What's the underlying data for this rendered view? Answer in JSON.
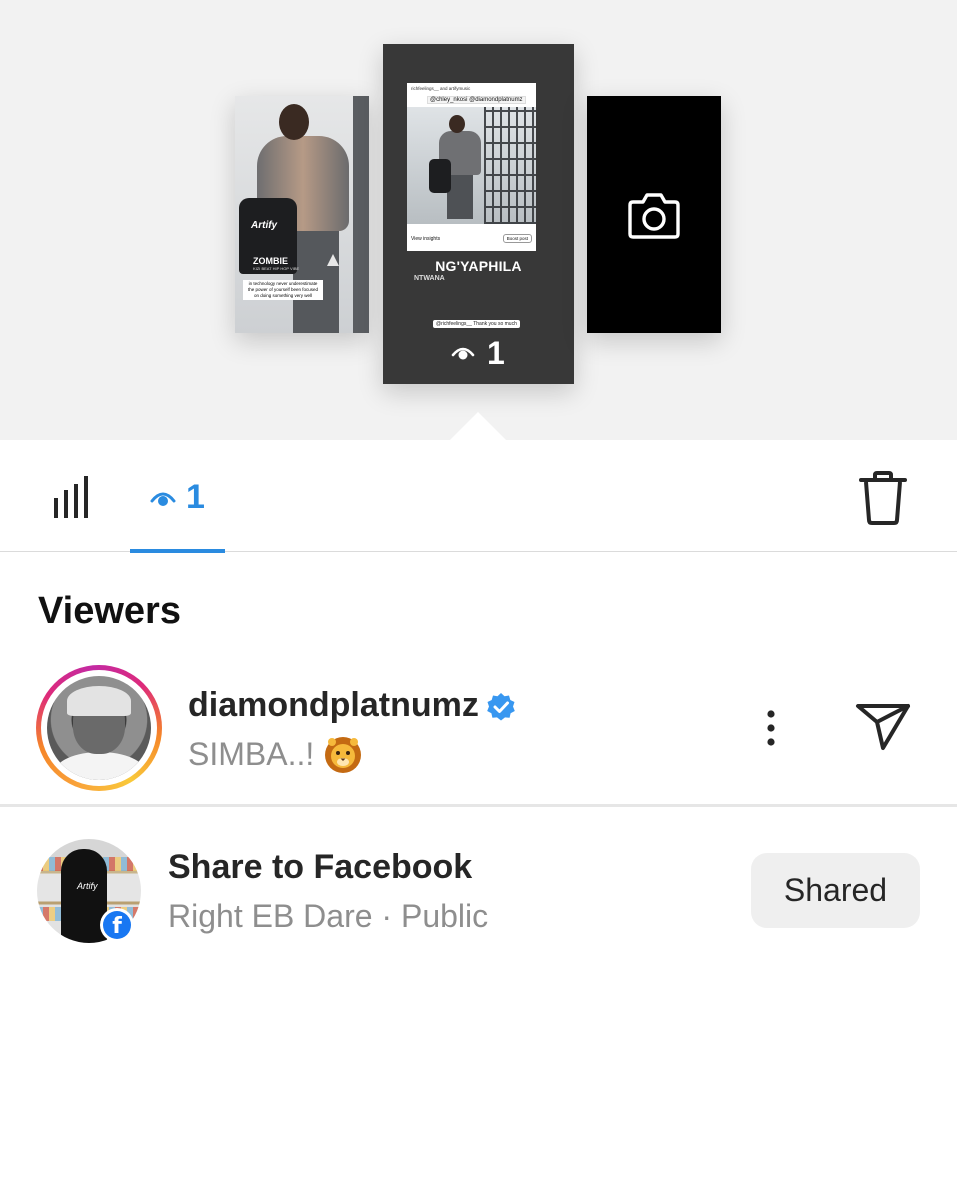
{
  "stories": {
    "left": {
      "bag_brand": "Artify",
      "title": "ZOMBIE",
      "subtitle": "KIZI BEAT HIP HOP VIBE",
      "caption": "in technology never underestimate the power of yourself been focused on doing something very well"
    },
    "center": {
      "post_header": "richfeelings__ and artifymusic",
      "post_tags": "@chley_nkosi @diamondplatnumz",
      "view_insights": "View insights",
      "boost_post": "Boost post",
      "title": "NG'YAPHILA",
      "subtitle": "NTWANA",
      "mention": "@richfeelings__ Thank you so much",
      "view_count": "1"
    },
    "right": {
      "icon": "camera-icon"
    }
  },
  "tabs": {
    "stats_icon": "bar-chart-icon",
    "viewers_icon": "eye-icon",
    "viewers_count": "1",
    "delete_icon": "trash-icon",
    "active_color": "#2a8be0"
  },
  "viewers": {
    "title": "Viewers",
    "items": [
      {
        "username": "diamondplatnumz",
        "verified": true,
        "subtitle": "SIMBA..!",
        "emoji": "lion-face-emoji"
      }
    ]
  },
  "share": {
    "title": "Share to Facebook",
    "subtitle": "Right EB Dare · Public",
    "avatar_text": "Artify",
    "badge_icon": "facebook-icon",
    "button_label": "Shared"
  },
  "colors": {
    "accent": "#2a8be0",
    "verified": "#3897f0",
    "facebook": "#1877f2",
    "secondary_text": "#8e8e8e"
  }
}
